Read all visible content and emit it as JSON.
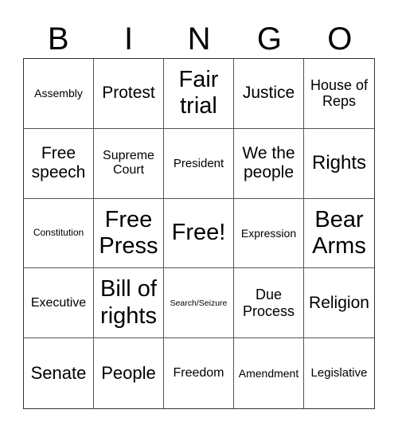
{
  "header": {
    "letters": [
      "B",
      "I",
      "N",
      "G",
      "O"
    ]
  },
  "cells": [
    "Assembly",
    "Protest",
    "Fair trial",
    "Justice",
    "House of Reps",
    "Free speech",
    "Supreme Court",
    "President",
    "We the people",
    "Rights",
    "Constitution",
    "Free Press",
    "Free!",
    "Expression",
    "Bear Arms",
    "Executive",
    "Bill of rights",
    "Search/Seizure",
    "Due Process",
    "Religion",
    "Senate",
    "People",
    "Freedom",
    "Amendment",
    "Legislative"
  ]
}
